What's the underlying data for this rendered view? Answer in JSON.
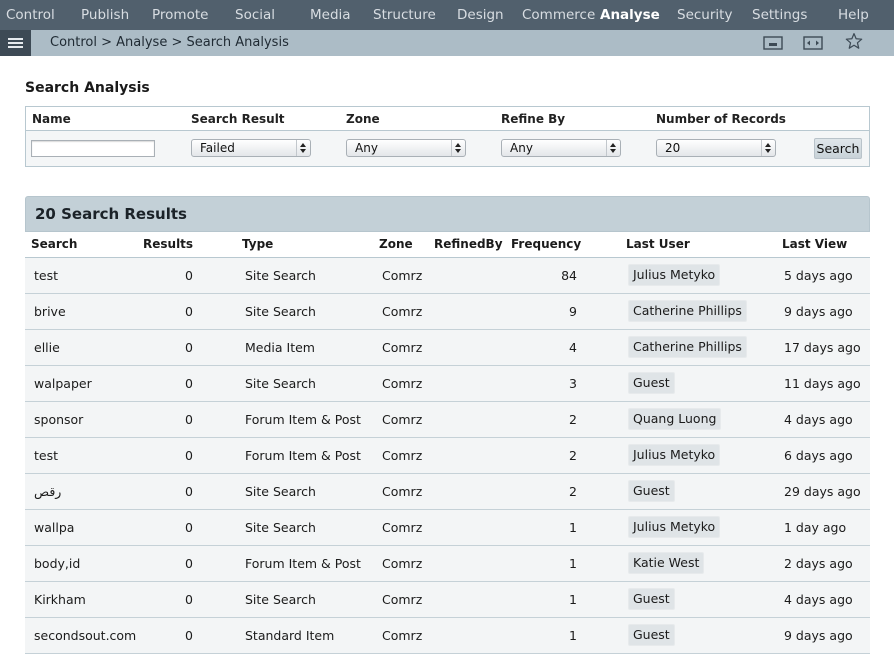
{
  "nav": {
    "items": [
      {
        "label": "Control",
        "active": false
      },
      {
        "label": "Publish",
        "active": false
      },
      {
        "label": "Promote",
        "active": false
      },
      {
        "label": "Social",
        "active": false
      },
      {
        "label": "Media",
        "active": false
      },
      {
        "label": "Structure",
        "active": false
      },
      {
        "label": "Design",
        "active": false
      },
      {
        "label": "Commerce",
        "active": false
      },
      {
        "label": "Analyse",
        "active": true
      },
      {
        "label": "Security",
        "active": false
      },
      {
        "label": "Settings",
        "active": false
      },
      {
        "label": "Help",
        "active": false
      }
    ]
  },
  "breadcrumb": "Control > Analyse > Search Analysis",
  "icons": {
    "menu": "hamburger-menu-icon",
    "window": "window-icon",
    "fullscreen": "fullscreen-icon",
    "favourite": "star-icon"
  },
  "colors": {
    "nav_bg": "#51606d",
    "crumb_bg": "#acbcc6",
    "results_header_bg": "#c3d0d7",
    "row_bg": "#f3f5f6"
  },
  "page_title": "Search Analysis",
  "filters": {
    "name_label": "Name",
    "name_value": "",
    "search_result_label": "Search Result",
    "search_result_value": "Failed",
    "zone_label": "Zone",
    "zone_value": "Any",
    "refine_label": "Refine By",
    "refine_value": "Any",
    "records_label": "Number of Records",
    "records_value": "20",
    "search_button": "Search"
  },
  "results": {
    "heading": "20 Search Results",
    "columns": {
      "search": "Search",
      "results": "Results",
      "type": "Type",
      "zone": "Zone",
      "refined_by": "RefinedBy",
      "frequency": "Frequency",
      "last_user": "Last User",
      "last_view": "Last View"
    },
    "rows": [
      {
        "search": "test",
        "results": "0",
        "type": "Site Search",
        "zone": "Comrz",
        "refined_by": "",
        "frequency": "84",
        "last_user": "Julius Metyko",
        "last_view": "5 days ago"
      },
      {
        "search": "brive",
        "results": "0",
        "type": "Site Search",
        "zone": "Comrz",
        "refined_by": "",
        "frequency": "9",
        "last_user": "Catherine Phillips",
        "last_view": "9 days ago"
      },
      {
        "search": "ellie",
        "results": "0",
        "type": "Media Item",
        "zone": "Comrz",
        "refined_by": "",
        "frequency": "4",
        "last_user": "Catherine Phillips",
        "last_view": "17 days ago"
      },
      {
        "search": "walpaper",
        "results": "0",
        "type": "Site Search",
        "zone": "Comrz",
        "refined_by": "",
        "frequency": "3",
        "last_user": "Guest",
        "last_view": "11 days ago"
      },
      {
        "search": "sponsor",
        "results": "0",
        "type": "Forum Item & Post",
        "zone": "Comrz",
        "refined_by": "",
        "frequency": "2",
        "last_user": "Quang Luong",
        "last_view": "4 days ago"
      },
      {
        "search": "test",
        "results": "0",
        "type": "Forum Item & Post",
        "zone": "Comrz",
        "refined_by": "",
        "frequency": "2",
        "last_user": "Julius Metyko",
        "last_view": "6 days ago"
      },
      {
        "search": "رقص",
        "results": "0",
        "type": "Site Search",
        "zone": "Comrz",
        "refined_by": "",
        "frequency": "2",
        "last_user": "Guest",
        "last_view": "29 days ago"
      },
      {
        "search": "wallpa",
        "results": "0",
        "type": "Site Search",
        "zone": "Comrz",
        "refined_by": "",
        "frequency": "1",
        "last_user": "Julius Metyko",
        "last_view": "1 day ago"
      },
      {
        "search": "body,id",
        "results": "0",
        "type": "Forum Item & Post",
        "zone": "Comrz",
        "refined_by": "",
        "frequency": "1",
        "last_user": "Katie West",
        "last_view": "2 days ago"
      },
      {
        "search": "Kirkham",
        "results": "0",
        "type": "Site Search",
        "zone": "Comrz",
        "refined_by": "",
        "frequency": "1",
        "last_user": "Guest",
        "last_view": "4 days ago"
      },
      {
        "search": "secondsout.com",
        "results": "0",
        "type": "Standard Item",
        "zone": "Comrz",
        "refined_by": "",
        "frequency": "1",
        "last_user": "Guest",
        "last_view": "9 days ago"
      }
    ]
  }
}
